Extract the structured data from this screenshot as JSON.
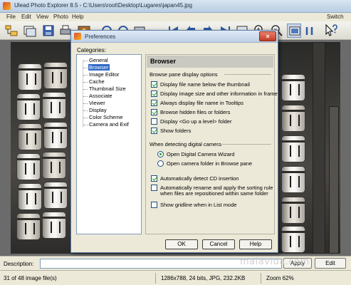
{
  "window": {
    "title": "Ulead Photo Explorer 8.5 - C:\\Users\\root\\Desktop\\Lugares\\japan45.jpg"
  },
  "menu": [
    "File",
    "Edit",
    "View",
    "Photo",
    "Help"
  ],
  "menu_right": "Switch",
  "dialog": {
    "title": "Preferences",
    "close_label": "×",
    "categories_label": "Categories:",
    "categories": [
      "General",
      "Browser",
      "Image Editor",
      "Cache",
      "Thumbnail Size",
      "Associate",
      "Viewer",
      "Display",
      "Color Scheme",
      "Camera and Exif"
    ],
    "selected_category": "Browser",
    "panel_title": "Browser",
    "section1": "Browse pane display options",
    "options": [
      {
        "label": "Display file name below the thumbnail",
        "checked": true
      },
      {
        "label": "Display image size and other information in frame",
        "checked": true
      },
      {
        "label": "Always display file name in Tooltips",
        "checked": true
      },
      {
        "label": "Browse hidden files or folders",
        "checked": true
      },
      {
        "label": "Display <Go up a level> folder",
        "checked": false
      },
      {
        "label": "Show folders",
        "checked": true
      }
    ],
    "section2": "When detecting digital camera",
    "radios": [
      {
        "label": "Open Digital Camera Wizard",
        "selected": true
      },
      {
        "label": "Open camera folder in Browse pane",
        "selected": false
      }
    ],
    "options2": [
      {
        "label": "Automatically detect CD insertion",
        "checked": true
      },
      {
        "label_line1": "Automatically rename and apply the sorting rule",
        "label_line2": "when files are repositioned within same folder",
        "checked": false
      },
      {
        "label": "Show gridline when in List mode",
        "checked": false
      }
    ],
    "buttons": {
      "ok": "OK",
      "cancel": "Cancel",
      "help": "Help"
    }
  },
  "description": {
    "label": "Description:",
    "apply": "Apply",
    "edit": "Edit"
  },
  "status": {
    "count": "31 of 48 image file(s)",
    "info": "1286x788, 24 bits, JPG, 232.2KB",
    "zoom": "Zoom 62%"
  },
  "watermark": "malavida.com",
  "colors": {
    "selection": "#316ac5",
    "titlebar": "#bfd0e6",
    "check": "#21a121"
  }
}
